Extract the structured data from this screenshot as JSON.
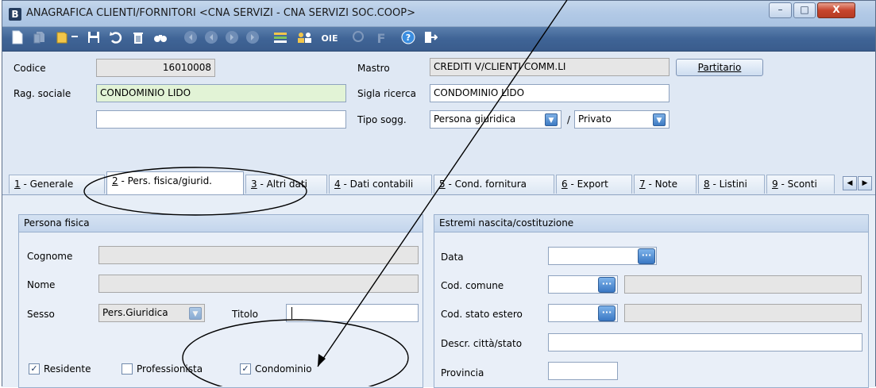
{
  "window": {
    "title": "ANAGRAFICA CLIENTI/FORNITORI <CNA SERVIZI - CNA SERVIZI SOC.COOP>",
    "app_icon": "B"
  },
  "toolbar_icons": [
    "new-icon",
    "copy-icon",
    "open-icon",
    "dropdown-icon",
    "save-icon",
    "undo-icon",
    "delete-icon",
    "find-icon",
    "first-icon",
    "prev-icon",
    "next-icon",
    "last-icon",
    "list-icon",
    "users-icon",
    "oie-icon",
    "help-icon",
    "exit-icon"
  ],
  "header": {
    "codice_label": "Codice",
    "codice_value": "16010008",
    "rag_label": "Rag. sociale",
    "rag_value": "CONDOMINIO LIDO",
    "rag_extra_value": "",
    "mastro_label": "Mastro",
    "mastro_value": "CREDITI V/CLIENTI COMM.LI",
    "partitario_label": "Partitario",
    "sigla_label": "Sigla ricerca",
    "sigla_value": "CONDOMINIO LIDO",
    "tipo_label": "Tipo sogg.",
    "tipo_value": "Persona giuridica",
    "tipo_sep": "/",
    "tipo2_value": "Privato"
  },
  "tabs": [
    {
      "key": "1",
      "label": " - Generale"
    },
    {
      "key": "2",
      "label": " - Pers. fisica/giurid."
    },
    {
      "key": "3",
      "label": " - Altri dati"
    },
    {
      "key": "4",
      "label": " - Dati contabili"
    },
    {
      "key": "5",
      "label": " - Cond. fornitura"
    },
    {
      "key": "6",
      "label": " - Export"
    },
    {
      "key": "7",
      "label": " - Note"
    },
    {
      "key": "8",
      "label": " - Listini"
    },
    {
      "key": "9",
      "label": " - Sconti"
    }
  ],
  "persona_fisica": {
    "title": "Persona fisica",
    "cognome_label": "Cognome",
    "cognome_value": "",
    "nome_label": "Nome",
    "nome_value": "",
    "sesso_label": "Sesso",
    "sesso_value": "Pers.Giuridica",
    "titolo_label": "Titolo",
    "titolo_value": "",
    "residente_label": "Residente",
    "residente_checked": true,
    "professionista_label": "Professionista",
    "professionista_checked": false,
    "condominio_label": "Condominio",
    "condominio_checked": true
  },
  "estremi": {
    "title": "Estremi nascita/costituzione",
    "data_label": "Data",
    "data_value": "",
    "comune_label": "Cod. comune",
    "comune_value": "",
    "comune_desc": "",
    "stato_label": "Cod. stato estero",
    "stato_value": "",
    "stato_desc": "",
    "citta_label": "Descr. città/stato",
    "citta_value": "",
    "provincia_label": "Provincia",
    "provincia_value": ""
  },
  "glyphs": {
    "dropdown": "▼",
    "ellipsis": "···",
    "check": "✓",
    "prev": "◀",
    "next": "▶",
    "minimize": "–",
    "maximize": "□",
    "close": "X"
  }
}
